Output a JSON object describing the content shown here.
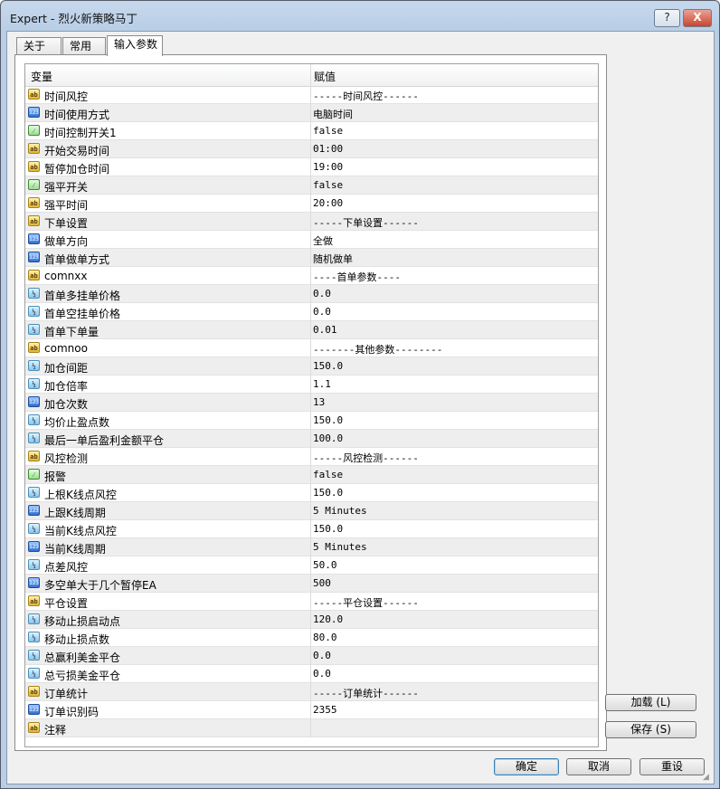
{
  "window": {
    "title": "Expert - 烈火新策略马丁",
    "help_label": "?",
    "close_label": "X"
  },
  "tabs": [
    {
      "label": "关于"
    },
    {
      "label": "常用"
    },
    {
      "label": "输入参数"
    }
  ],
  "grid": {
    "header_variable": "变量",
    "header_value": "赋值",
    "rows": [
      {
        "icon": "ab",
        "name": "时间风控",
        "value": "-----时间风控------"
      },
      {
        "icon": "123",
        "name": "时间使用方式",
        "value": "电脑时间"
      },
      {
        "icon": "bool",
        "name": "时间控制开关1",
        "value": "false"
      },
      {
        "icon": "ab",
        "name": "开始交易时间",
        "value": "01:00"
      },
      {
        "icon": "ab",
        "name": "暂停加仓时间",
        "value": "19:00"
      },
      {
        "icon": "bool",
        "name": "强平开关",
        "value": "false"
      },
      {
        "icon": "ab",
        "name": "强平时间",
        "value": "20:00"
      },
      {
        "icon": "ab",
        "name": "下单设置",
        "value": "-----下单设置------"
      },
      {
        "icon": "123",
        "name": "做单方向",
        "value": "全做"
      },
      {
        "icon": "123",
        "name": "首单做单方式",
        "value": "随机做单"
      },
      {
        "icon": "ab",
        "name": "comnxx",
        "value": "----首单参数----"
      },
      {
        "icon": "half",
        "name": "首单多挂单价格",
        "value": "0.0"
      },
      {
        "icon": "half",
        "name": "首单空挂单价格",
        "value": "0.0"
      },
      {
        "icon": "half",
        "name": "首单下单量",
        "value": "0.01"
      },
      {
        "icon": "ab",
        "name": "comnoo",
        "value": "-------其他参数--------"
      },
      {
        "icon": "half",
        "name": "加仓间距",
        "value": "150.0"
      },
      {
        "icon": "half",
        "name": "加仓倍率",
        "value": "1.1"
      },
      {
        "icon": "123",
        "name": "加仓次数",
        "value": "13"
      },
      {
        "icon": "half",
        "name": "均价止盈点数",
        "value": "150.0"
      },
      {
        "icon": "half",
        "name": "最后一单后盈利金额平仓",
        "value": "100.0"
      },
      {
        "icon": "ab",
        "name": "风控检测",
        "value": "-----风控检测------"
      },
      {
        "icon": "bool",
        "name": "报警",
        "value": "false"
      },
      {
        "icon": "half",
        "name": "上根K线点风控",
        "value": "150.0"
      },
      {
        "icon": "123",
        "name": "上跟K线周期",
        "value": "5 Minutes"
      },
      {
        "icon": "half",
        "name": "当前K线点风控",
        "value": "150.0"
      },
      {
        "icon": "123",
        "name": "当前K线周期",
        "value": "5 Minutes"
      },
      {
        "icon": "half",
        "name": "点差风控",
        "value": "50.0"
      },
      {
        "icon": "123",
        "name": "多空单大于几个暂停EA",
        "value": "500"
      },
      {
        "icon": "ab",
        "name": "平仓设置",
        "value": "-----平仓设置------"
      },
      {
        "icon": "half",
        "name": "移动止损启动点",
        "value": "120.0"
      },
      {
        "icon": "half",
        "name": "移动止损点数",
        "value": "80.0"
      },
      {
        "icon": "half",
        "name": "总赢利美金平仓",
        "value": "0.0"
      },
      {
        "icon": "half",
        "name": "总亏损美金平仓",
        "value": "0.0"
      },
      {
        "icon": "ab",
        "name": "订单统计",
        "value": "-----订单统计------"
      },
      {
        "icon": "123",
        "name": "订单识别码",
        "value": "2355"
      },
      {
        "icon": "ab",
        "name": "注释",
        "value": ""
      }
    ]
  },
  "side_buttons": {
    "load_label": "加载 (L)",
    "save_label": "保存 (S)"
  },
  "footer": {
    "ok_label": "确定",
    "cancel_label": "取消",
    "reset_label": "重设"
  },
  "icon_glyphs": {
    "ab": "ab",
    "123": "123",
    "half": "½",
    "bool": "⁄"
  }
}
